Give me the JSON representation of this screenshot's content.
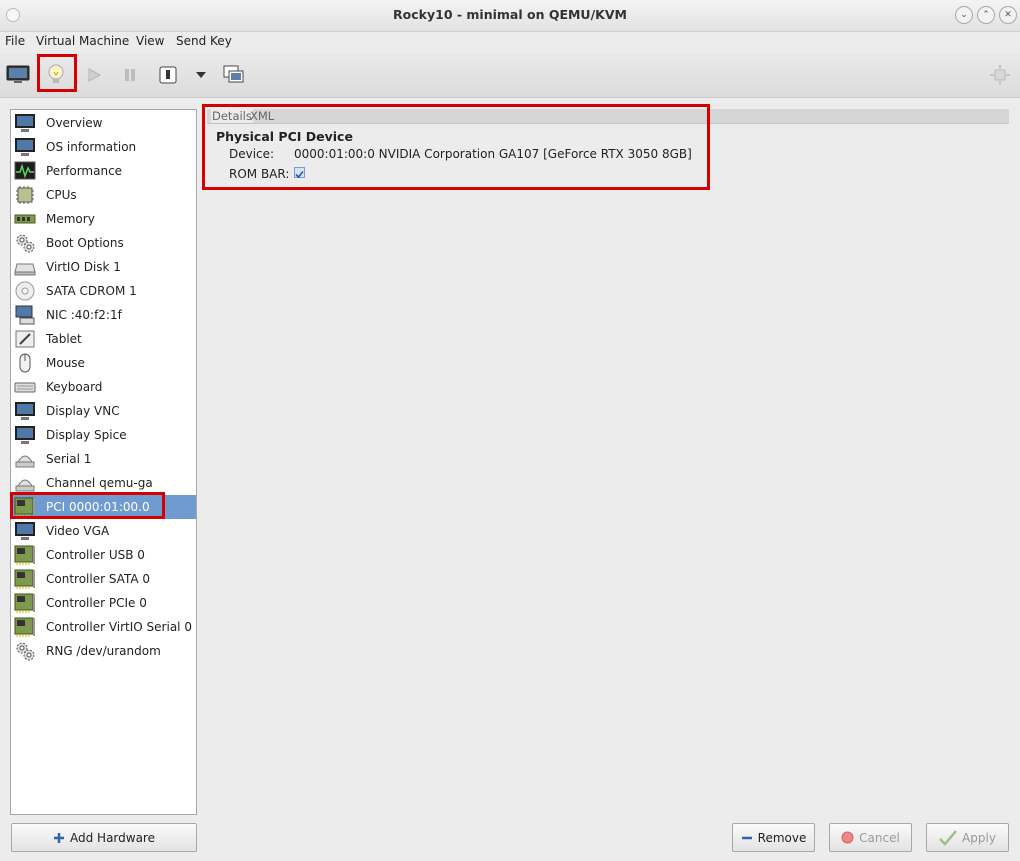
{
  "window": {
    "title": "Rocky10 - minimal on QEMU/KVM"
  },
  "menu": [
    "File",
    "Virtual Machine",
    "View",
    "Send Key"
  ],
  "sidebar": {
    "items": [
      {
        "label": "Overview",
        "icon": "monitor-icon"
      },
      {
        "label": "OS information",
        "icon": "monitor-icon"
      },
      {
        "label": "Performance",
        "icon": "performance-icon"
      },
      {
        "label": "CPUs",
        "icon": "cpu-icon"
      },
      {
        "label": "Memory",
        "icon": "memory-icon"
      },
      {
        "label": "Boot Options",
        "icon": "gears-icon"
      },
      {
        "label": "VirtIO Disk 1",
        "icon": "disk-icon"
      },
      {
        "label": "SATA CDROM 1",
        "icon": "cdrom-icon"
      },
      {
        "label": "NIC :40:f2:1f",
        "icon": "nic-icon"
      },
      {
        "label": "Tablet",
        "icon": "tablet-icon"
      },
      {
        "label": "Mouse",
        "icon": "mouse-icon"
      },
      {
        "label": "Keyboard",
        "icon": "keyboard-icon"
      },
      {
        "label": "Display VNC",
        "icon": "monitor-icon"
      },
      {
        "label": "Display Spice",
        "icon": "monitor-icon"
      },
      {
        "label": "Serial 1",
        "icon": "serial-icon"
      },
      {
        "label": "Channel qemu-ga",
        "icon": "serial-icon"
      },
      {
        "label": "PCI 0000:01:00.0",
        "icon": "pci-card-icon",
        "selected": true
      },
      {
        "label": "Video VGA",
        "icon": "monitor-icon"
      },
      {
        "label": "Controller USB 0",
        "icon": "pci-card-icon"
      },
      {
        "label": "Controller SATA 0",
        "icon": "pci-card-icon"
      },
      {
        "label": "Controller PCIe 0",
        "icon": "pci-card-icon"
      },
      {
        "label": "Controller VirtIO Serial 0",
        "icon": "pci-card-icon"
      },
      {
        "label": "RNG /dev/urandom",
        "icon": "gears-icon"
      }
    ],
    "add_hardware_label": "Add Hardware"
  },
  "details": {
    "tabs": [
      "Details",
      "XML"
    ],
    "section_title": "Physical PCI Device",
    "device_label": "Device:",
    "device_value": "0000:01:00:0 NVIDIA Corporation GA107 [GeForce RTX 3050 8GB]",
    "rom_bar_label": "ROM BAR:",
    "rom_bar_checked": true
  },
  "buttons": {
    "remove": "Remove",
    "cancel": "Cancel",
    "apply": "Apply"
  },
  "colors": {
    "selection": "#6f9bd1",
    "highlight": "#d60000"
  }
}
